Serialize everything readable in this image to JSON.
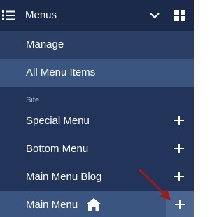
{
  "header": {
    "title": "Menus"
  },
  "items": {
    "manage": "Manage",
    "all": "All Menu Items"
  },
  "section": {
    "label": "Site"
  },
  "menus": {
    "special": "Special Menu",
    "bottom": "Bottom Menu",
    "blog": "Main Menu Blog",
    "main": "Main Menu"
  },
  "colors": {
    "panel": "#22335a",
    "header": "#1b2a4a",
    "highlight": "#3a5680",
    "arrow": "#9b1c1c"
  }
}
